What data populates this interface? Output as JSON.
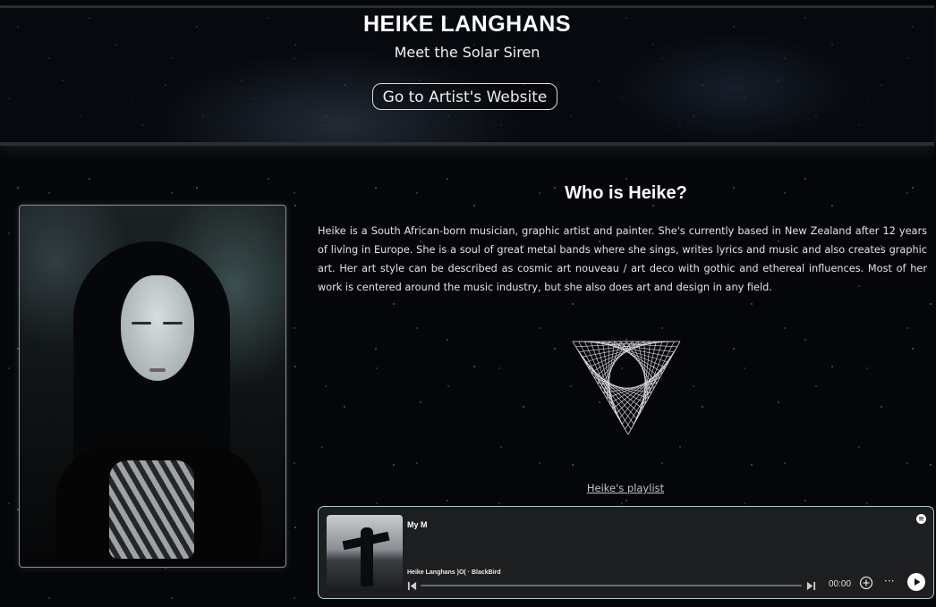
{
  "header": {
    "title": "HEIKE LANGHANS",
    "subtitle": "Meet the Solar Siren",
    "website_button_label": "Go to Artist's Website"
  },
  "bio": {
    "heading": "Who is Heike?",
    "text": "Heike is a South African-born musician, graphic artist and painter. She's currently based in New Zealand after 12 years of living in Europe. She is a soul of great metal bands where she sings, writes lyrics and music and also creates graphic art. Her art style can be described as cosmic art nouveau / art deco with gothic and ethereal influences. Most of her work is centered around the music industry, but she also does art and design in any field."
  },
  "playlist": {
    "link_label": "Heike's playlist"
  },
  "player": {
    "title": "My M",
    "track": "Heike Langhans )O( · BlackBird",
    "time": "00:00",
    "more_label": "···",
    "progress": 0,
    "border_color": "#9fd0e0"
  },
  "icons": {
    "spotify": "spotify-logo-icon",
    "prev": "skip-previous-icon",
    "next": "skip-next-icon",
    "add": "add-circle-icon",
    "more": "more-options-icon",
    "play": "play-icon",
    "logo": "geometric-triangle-logo-icon"
  }
}
